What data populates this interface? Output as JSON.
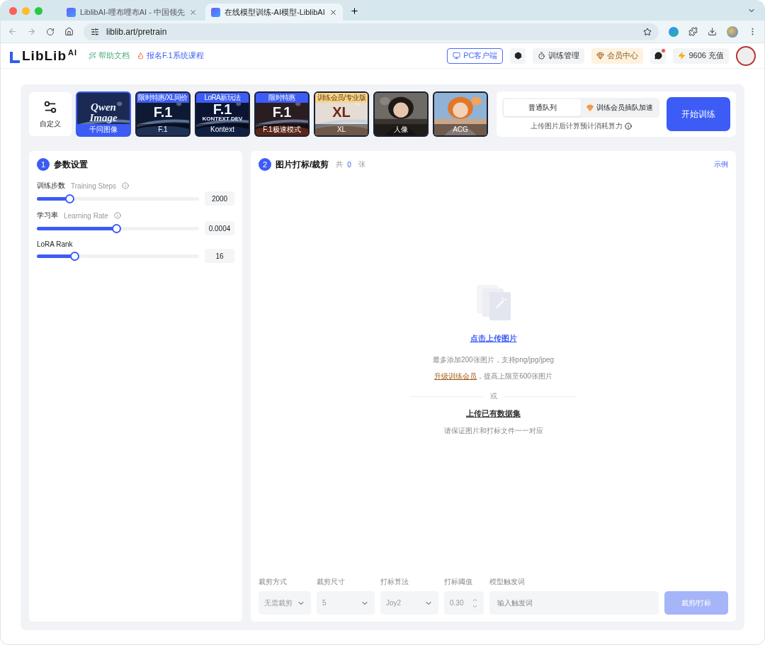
{
  "browser": {
    "tabs": [
      {
        "title": "LiblibAI-哩布哩布AI - 中国领先",
        "selected": false
      },
      {
        "title": "在线模型训练-AI模型-LiblibAI",
        "selected": true
      }
    ],
    "url": "liblib.art/pretrain"
  },
  "header": {
    "logo": "LibLib",
    "logo_sup": "AI",
    "links": [
      {
        "label": "帮助文档",
        "kind": "help"
      },
      {
        "label": "报名F.1系统课程",
        "kind": "course"
      }
    ],
    "pc_client": "PC客户端",
    "training": "训练管理",
    "member": "会员中心",
    "messages_unread": true,
    "credits": "9606 充值"
  },
  "models": [
    {
      "kind": "custom",
      "label": "自定义",
      "selected": false
    },
    {
      "kind": "logo",
      "label": "千问图像",
      "art_text": [
        "Qwen",
        "Image"
      ],
      "selected": true
    },
    {
      "kind": "logo",
      "label": "F.1",
      "art_text": [
        "F.1"
      ],
      "badge": {
        "text": "限时特惠/XL同价",
        "color": "#3d5cf5"
      },
      "selected": false
    },
    {
      "kind": "logo",
      "label": "Kontext",
      "art_text": [
        "F.1",
        "KONTEXT DEV"
      ],
      "badge": {
        "text": "LoRA新玩法",
        "color": "#3d5cf5"
      },
      "selected": false
    },
    {
      "kind": "logo",
      "label": "F.1极速模式",
      "art_text": [
        "F.1"
      ],
      "badge": {
        "text": "限时特惠",
        "color": "#3d5cf5"
      },
      "selected": false
    },
    {
      "kind": "logo",
      "label": "XL",
      "art_text": [
        "XL"
      ],
      "badge": {
        "text": "训练会员/专业版",
        "color": "#f6d68c"
      },
      "selected": false
    },
    {
      "label": "人像",
      "selected": false
    },
    {
      "label": "ACG",
      "selected": false
    }
  ],
  "queue": {
    "options": [
      {
        "label": "普通队列",
        "selected": true
      },
      {
        "label": "训练会员插队加速",
        "selected": false
      }
    ],
    "note": "上传图片后计算预计消耗算力"
  },
  "start_button": "开始训练",
  "params": {
    "step": "1",
    "title": "参数设置",
    "items": [
      {
        "label": "训练步数",
        "sub": "Training Steps",
        "info": true,
        "level": 0.2,
        "value": "2000"
      },
      {
        "label": "学习率",
        "sub": "Learning Rate",
        "info": true,
        "level": 0.49,
        "value": "0.0004"
      },
      {
        "label": "LoRA Rank",
        "info": false,
        "level": 0.23,
        "value": "16"
      }
    ]
  },
  "images": {
    "step": "2",
    "title": "图片打标/裁剪",
    "count_prefix": "共",
    "count": "0",
    "count_suffix": "张",
    "example_link": "示例",
    "upload_link": "点击上传图片",
    "limit_note": "最多添加200张图片，支持png/jpg/jpeg",
    "upgrade_link": "升级训练会员",
    "upgrade_note": "，提高上限至600张图片",
    "or": "或",
    "dataset_link": "上传已有数据集",
    "dataset_note": "请保证图片和打标文件一一对应",
    "form": [
      {
        "kind": "select",
        "label": "裁剪方式",
        "value": "无需裁剪",
        "disabled": true
      },
      {
        "kind": "select",
        "label": "裁剪尺寸",
        "value": "5",
        "disabled": true
      },
      {
        "kind": "select",
        "label": "打标算法",
        "value": "Joy2",
        "disabled": true
      },
      {
        "kind": "number",
        "label": "打标阈值",
        "value": "0.30",
        "disabled": true
      },
      {
        "kind": "text",
        "label": "模型触发词",
        "placeholder": "输入触发词",
        "disabled": false
      }
    ],
    "action": {
      "label": "裁剪/打标",
      "disabled": true
    }
  }
}
